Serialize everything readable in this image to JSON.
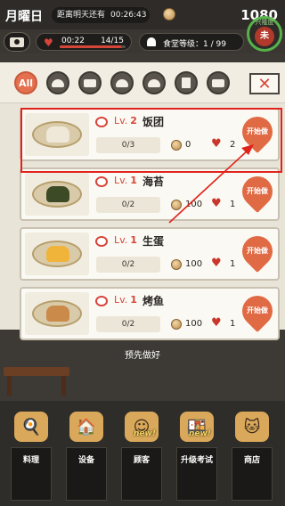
{
  "header": {
    "day": "月曜日",
    "countdown_label": "距离明天还有",
    "countdown_time": "00:26:43",
    "money": "1080"
  },
  "status": {
    "stamina_time": "00:22",
    "stamina_count": "14/15",
    "stamina_progress": 0.93,
    "canteen_level_label": "食堂等级：",
    "canteen_level": "1 / 99",
    "prosperity_label": "兴隆度",
    "prosperity_char": "未"
  },
  "filters": {
    "all_label": "All",
    "icons": [
      "rice-bowl-icon",
      "rice-ball-icon",
      "dish-icon",
      "noodle-bowl-icon",
      "drink-cup-icon",
      "cake-icon"
    ],
    "close_icon": "close-icon"
  },
  "recipes": [
    {
      "level_prefix": "Lv.",
      "level": "2",
      "name": "饭团",
      "progress": "0/3",
      "price": "0",
      "hearts": "2",
      "start": "开始做",
      "food_color": "#efe8d8"
    },
    {
      "level_prefix": "Lv.",
      "level": "1",
      "name": "海苔",
      "progress": "0/2",
      "price": "100",
      "hearts": "1",
      "start": "开始做",
      "food_color": "#3c4a26"
    },
    {
      "level_prefix": "Lv.",
      "level": "1",
      "name": "生蛋",
      "progress": "0/2",
      "price": "100",
      "hearts": "1",
      "start": "开始做",
      "food_color": "#f0b43a"
    },
    {
      "level_prefix": "Lv.",
      "level": "1",
      "name": "烤鱼",
      "progress": "0/2",
      "price": "100",
      "hearts": "1",
      "start": "开始做",
      "food_color": "#c98a4a"
    }
  ],
  "hint": "预先做好",
  "dock": [
    {
      "label": "料理",
      "icon": "cooking-icon",
      "new": ""
    },
    {
      "label": "设备",
      "icon": "shop-building-icon",
      "new": ""
    },
    {
      "label": "顾客",
      "icon": "customers-icon",
      "new": "new!"
    },
    {
      "label": "升级考试",
      "icon": "exam-food-icon",
      "new": "new!"
    },
    {
      "label": "商店",
      "icon": "lucky-cat-icon",
      "new": ""
    }
  ],
  "colors": {
    "accent": "#e06a44",
    "highlight": "#e0231b",
    "heart": "#c9372c"
  }
}
